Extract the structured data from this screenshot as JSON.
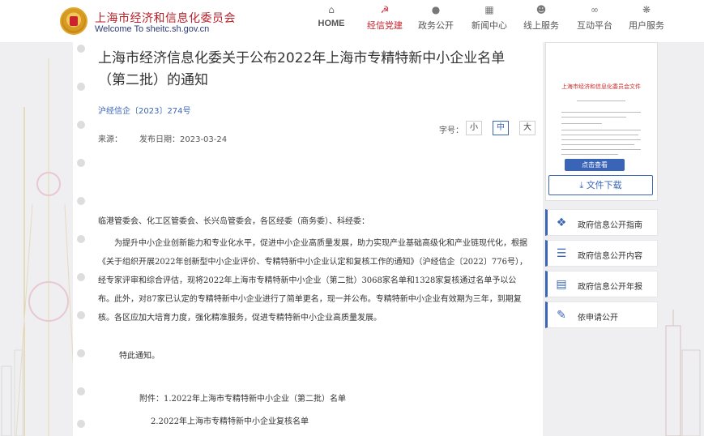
{
  "header": {
    "site_title": "上海市经济和信息化委员会",
    "site_subtitle": "Welcome To sheitc.sh.gov.cn",
    "nav": [
      {
        "label": "HOME",
        "icon": "home-icon",
        "active": false
      },
      {
        "label": "经信党建",
        "icon": "party-emblem-icon",
        "active": true
      },
      {
        "label": "政务公开",
        "icon": "chat-icon",
        "active": false
      },
      {
        "label": "新闻中心",
        "icon": "news-icon",
        "active": false
      },
      {
        "label": "线上服务",
        "icon": "user-service-icon",
        "active": false
      },
      {
        "label": "互动平台",
        "icon": "interaction-icon",
        "active": false
      },
      {
        "label": "用户服务",
        "icon": "gear-icon",
        "active": false
      }
    ]
  },
  "article": {
    "title": "上海市经济信息化委关于公布2022年上海市专精特新中小企业名单（第二批）的通知",
    "doc_number": "沪经信企〔2023〕274号",
    "source_label": "来源：",
    "date_label": "发布日期：2023-03-24",
    "font_size_label": "字号：",
    "font_sizes": [
      "小",
      "中",
      "大"
    ],
    "addressees": "临港管委会、化工区管委会、长兴岛管委会，各区经委（商务委）、科经委：",
    "main_paragraph": "为提升中小企业创新能力和专业化水平，促进中小企业高质量发展，助力实现产业基础高级化和产业链现代化，根据《关于组织开展2022年创新型中小企业评价、专精特新中小企业认定和复核工作的通知》（沪经信企〔2022〕776号），经专家评审和综合评估，现将2022年上海市专精特新中小企业（第二批）3068家名单和1328家复核通过名单予以公布。此外，对87家已认定的专精特新中小企业进行了简单更名，现一并公布。专精特新中小企业有效期为三年，到期复核。各区应加大培育力度，强化精准服务，促进专精特新中小企业高质量发展。",
    "notice": "特此通知。",
    "attachment_1": "附件：1.2022年上海市专精特新中小企业（第二批）名单",
    "attachment_2": "2.2022年上海市专精特新中小企业复核名单"
  },
  "sidebar": {
    "doc_preview_title": "上海市经济和信息化委员会文件",
    "view_button": "点击查看",
    "download_button": "文件下载",
    "links": [
      {
        "label": "政府信息公开指南",
        "icon": "compass-icon"
      },
      {
        "label": "政府信息公开内容",
        "icon": "list-icon"
      },
      {
        "label": "政府信息公开年报",
        "icon": "report-icon"
      },
      {
        "label": "依申请公开",
        "icon": "apply-form-icon"
      }
    ]
  },
  "colors": {
    "brand_red": "#c9232d",
    "link_blue": "#3a65b7",
    "page_bg": "#efeef0"
  }
}
